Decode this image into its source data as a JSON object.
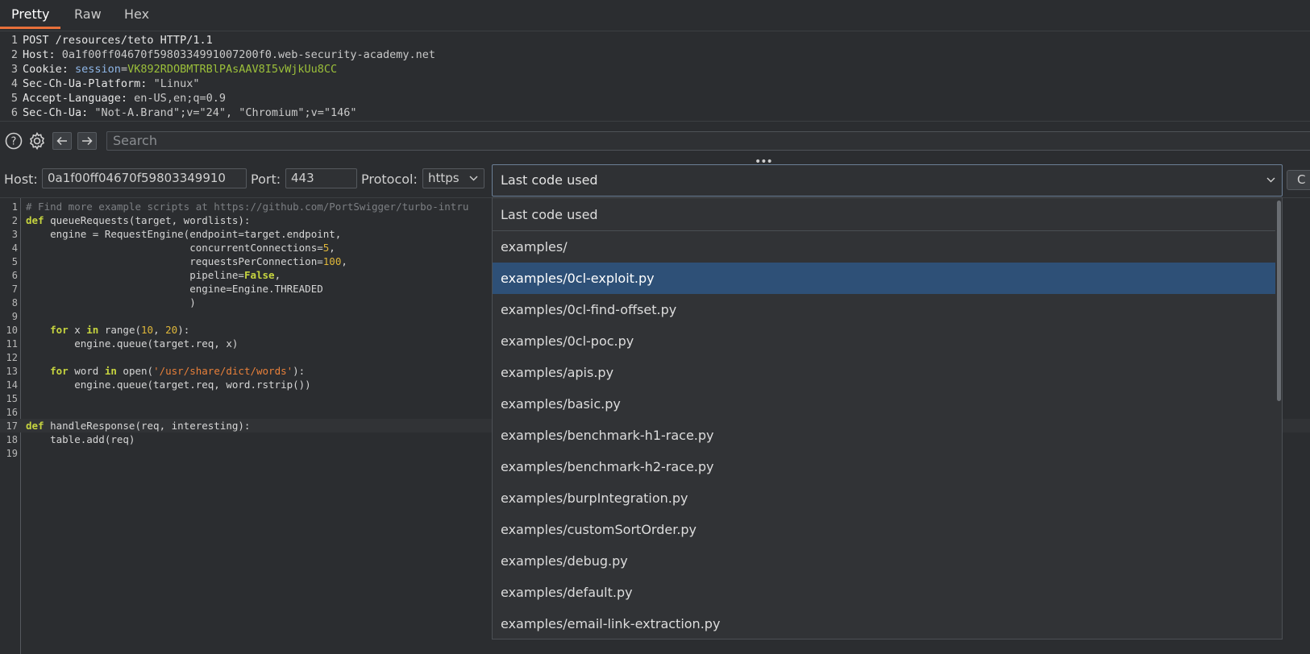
{
  "tabs": [
    "Pretty",
    "Raw",
    "Hex"
  ],
  "request_lines": [
    {
      "n": "1",
      "key": "",
      "value": "POST /resources/teto HTTP/1.1"
    },
    {
      "n": "2",
      "key": "Host:",
      "value": " 0a1f00ff04670f5980334991007200f0.web-security-academy.net"
    },
    {
      "n": "3",
      "key": "Cookie:",
      "cookie_name": " session",
      "cookie_eq": "=",
      "cookie_value": "VK892RDOBMTRBlPAsAAV8I5vWjkUu8CC"
    },
    {
      "n": "4",
      "key": "Sec-Ch-Ua-Platform:",
      "value": " \"Linux\""
    },
    {
      "n": "5",
      "key": "Accept-Language:",
      "value": " en-US,en;q=0.9"
    },
    {
      "n": "6",
      "key": "Sec-Ch-Ua:",
      "value": " \"Not-A.Brand\";v=\"24\", \"Chromium\";v=\"146\""
    }
  ],
  "search": {
    "placeholder": "Search"
  },
  "host_row": {
    "host_label": "Host:",
    "host_value": "0a1f00ff04670f59803349910",
    "port_label": "Port:",
    "port_value": "443",
    "protocol_label": "Protocol:",
    "protocol_value": "https",
    "combo_value": "Last code used",
    "start_button": "C"
  },
  "editor": {
    "line_numbers": [
      "1",
      "2",
      "3",
      "4",
      "5",
      "6",
      "7",
      "8",
      "9",
      "10",
      "11",
      "12",
      "13",
      "14",
      "15",
      "16",
      "17",
      "18",
      "19"
    ],
    "l1": "# Find more example scripts at https://github.com/PortSwigger/turbo-intru",
    "l2_kw": "def",
    "l2": " queueRequests(target, wordlists):",
    "l3": "    engine = RequestEngine(endpoint=target.endpoint,",
    "l4a": "                           concurrentConnections=",
    "l4n": "5",
    "l4b": ",",
    "l5a": "                           requestsPerConnection=",
    "l5n": "100",
    "l5b": ",",
    "l6a": "                           pipeline=",
    "l6k": "False",
    "l6b": ",",
    "l7": "                           engine=Engine.THREADED",
    "l8": "                           )",
    "l10_kw1": "for",
    "l10a": " x ",
    "l10_kw2": "in",
    "l10b": " range(",
    "l10n1": "10",
    "l10c": ", ",
    "l10n2": "20",
    "l10d": "):",
    "l11": "        engine.queue(target.req, x)",
    "l13_kw1": "for",
    "l13a": " word ",
    "l13_kw2": "in",
    "l13b": " open(",
    "l13s": "'/usr/share/dict/words'",
    "l13c": "):",
    "l14": "        engine.queue(target.req, word.rstrip())",
    "l17_kw": "def",
    "l17": " handleResponse(req, interesting):",
    "l18": "    table.add(req)"
  },
  "dropdown": {
    "options": [
      "Last code used",
      "examples/",
      "examples/0cl-exploit.py",
      "examples/0cl-find-offset.py",
      "examples/0cl-poc.py",
      "examples/apis.py",
      "examples/basic.py",
      "examples/benchmark-h1-race.py",
      "examples/benchmark-h2-race.py",
      "examples/burpIntegration.py",
      "examples/customSortOrder.py",
      "examples/debug.py",
      "examples/default.py",
      "examples/email-link-extraction.py"
    ],
    "selected": "examples/0cl-exploit.py"
  },
  "colors": {
    "accent_tab": "#e8703a",
    "selection": "#2e5077",
    "keyword": "#c6d43f",
    "number": "#e0b83a",
    "string": "#e8803a",
    "cookie_value": "#9bbf3a"
  }
}
